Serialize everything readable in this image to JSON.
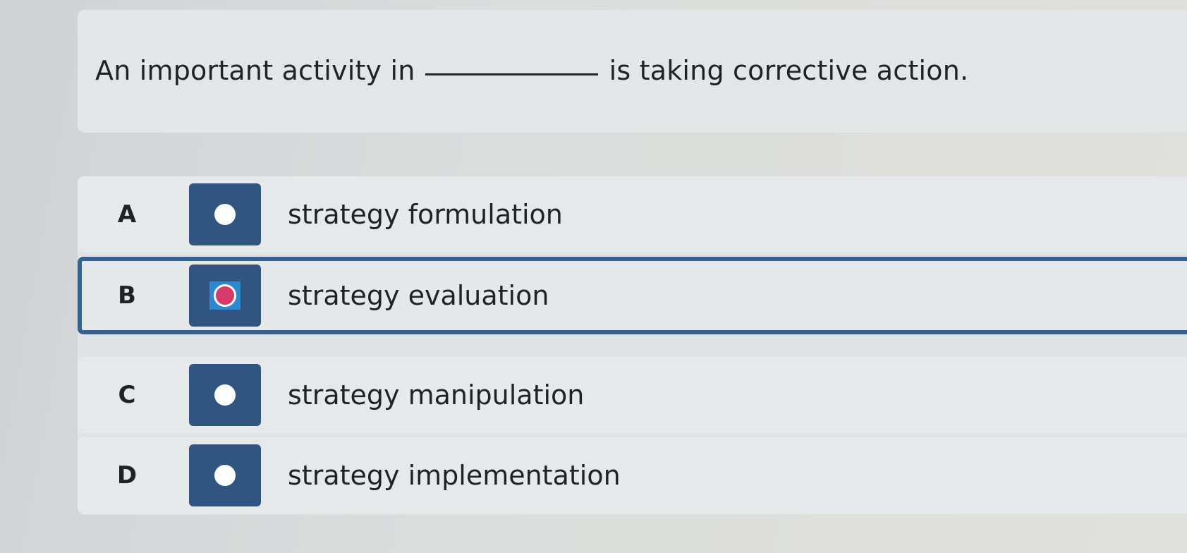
{
  "question": {
    "before_blank": "An important activity in",
    "after_blank": "is taking corrective action."
  },
  "options": [
    {
      "letter": "A",
      "label": "strategy formulation",
      "selected": false
    },
    {
      "letter": "B",
      "label": "strategy evaluation",
      "selected": true
    },
    {
      "letter": "C",
      "label": "strategy manipulation",
      "selected": false
    },
    {
      "letter": "D",
      "label": "strategy implementation",
      "selected": false
    }
  ],
  "colors": {
    "radio_box": "#2f5580",
    "selected_border": "#35628f",
    "checked_dot": "#d63a6b",
    "focus_ring": "#2f86d1"
  }
}
